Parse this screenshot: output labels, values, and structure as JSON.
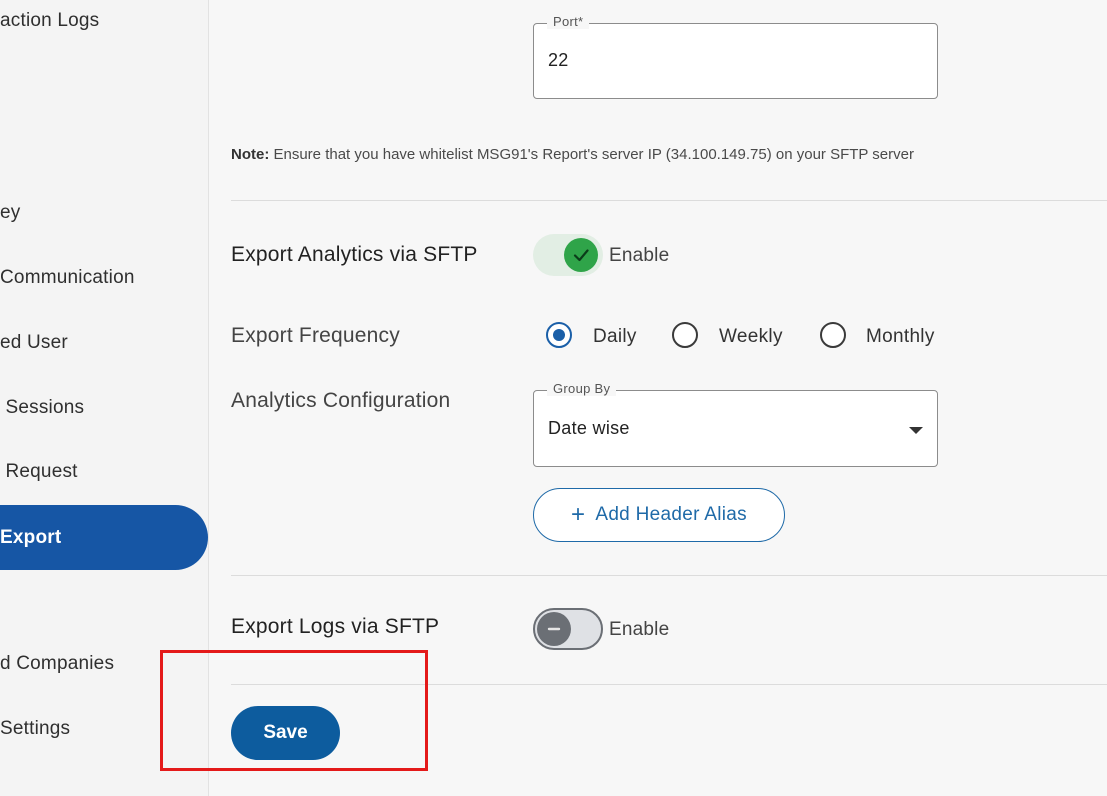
{
  "sidebar": {
    "items": [
      {
        "label": "action Logs"
      },
      {
        "label": "ey"
      },
      {
        "label": "Communication"
      },
      {
        "label": "ed User"
      },
      {
        "label": " Sessions"
      },
      {
        "label": " Request"
      },
      {
        "label": "Export",
        "active": true
      },
      {
        "label": "d Companies"
      },
      {
        "label": "Settings"
      }
    ]
  },
  "port": {
    "label": "Port*",
    "value": "22"
  },
  "note": {
    "bold": "Note:",
    "text": " Ensure that you have whitelist MSG91's Report's server IP (34.100.149.75) on your SFTP server"
  },
  "analytics": {
    "title": "Export Analytics via SFTP",
    "toggle_label": "Enable",
    "toggle_on": true,
    "frequency_label": "Export Frequency",
    "frequency_options": [
      "Daily",
      "Weekly",
      "Monthly"
    ],
    "frequency_selected": "Daily",
    "config_label": "Analytics Configuration",
    "group_by": {
      "label": "Group By",
      "value": "Date wise"
    },
    "add_header_alias": "Add Header Alias"
  },
  "logs": {
    "title": "Export Logs via SFTP",
    "toggle_label": "Enable",
    "toggle_on": false
  },
  "save_label": "Save",
  "colors": {
    "accent": "#1656a5",
    "toggle_on": "#2fa449",
    "highlight": "#e41a1a"
  },
  "icons": {
    "plus": "plus-icon",
    "check": "check-icon",
    "minus": "minus-icon",
    "dropdown": "chevron-down-icon"
  }
}
